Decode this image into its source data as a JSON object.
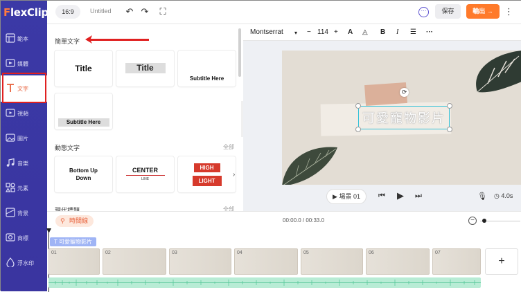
{
  "app": {
    "logo_f": "F",
    "logo_rest": "lexClip"
  },
  "sidebar": {
    "items": [
      {
        "label": "範本",
        "icon": "template-icon"
      },
      {
        "label": "媒體",
        "icon": "media-icon"
      },
      {
        "label": "文字",
        "icon": "text-icon",
        "active": true
      },
      {
        "label": "視頻",
        "icon": "video-icon"
      },
      {
        "label": "圖片",
        "icon": "image-icon"
      },
      {
        "label": "音樂",
        "icon": "music-icon"
      },
      {
        "label": "元素",
        "icon": "elements-icon"
      },
      {
        "label": "背景",
        "icon": "background-icon"
      },
      {
        "label": "商標",
        "icon": "logo-icon"
      },
      {
        "label": "浮水印",
        "icon": "watermark-icon"
      }
    ]
  },
  "topbar": {
    "ratio": "16:9",
    "project_title": "Untitled",
    "save_label": "保存",
    "export_label": "輸出 →"
  },
  "panel": {
    "simple_text_title": "簡單文字",
    "animated_text_title": "動態文字",
    "animated_text_all": "全部",
    "modern_title": "現代標題",
    "modern_all": "全部",
    "cards": {
      "title1": "Title",
      "title2": "Title",
      "subtitle1": "Subtitle Here",
      "subtitle2": "Subtitle Here",
      "bottom_up": "Bottom Up Down",
      "center": "CENTER",
      "line": "LINE",
      "high": "HIGH",
      "light": "LIGHT"
    }
  },
  "format_bar": {
    "font": "Montserrat",
    "size": "114",
    "minus": "−",
    "plus": "+"
  },
  "canvas": {
    "text": "可愛寵物影片"
  },
  "player": {
    "scene": "場景 01",
    "duration": "4.0s"
  },
  "timeline": {
    "timeline_label": "時間線",
    "timecode": "00:00.0 / 00:33.0",
    "text_layer": "T 可愛寵物影片",
    "clip_numbers": [
      "01",
      "02",
      "03",
      "04",
      "05",
      "06",
      "07"
    ],
    "add_label": "+"
  },
  "colors": {
    "sidebar_bg": "#3b39a6",
    "accent": "#ff7a2a",
    "highlight_red": "#e02020"
  }
}
